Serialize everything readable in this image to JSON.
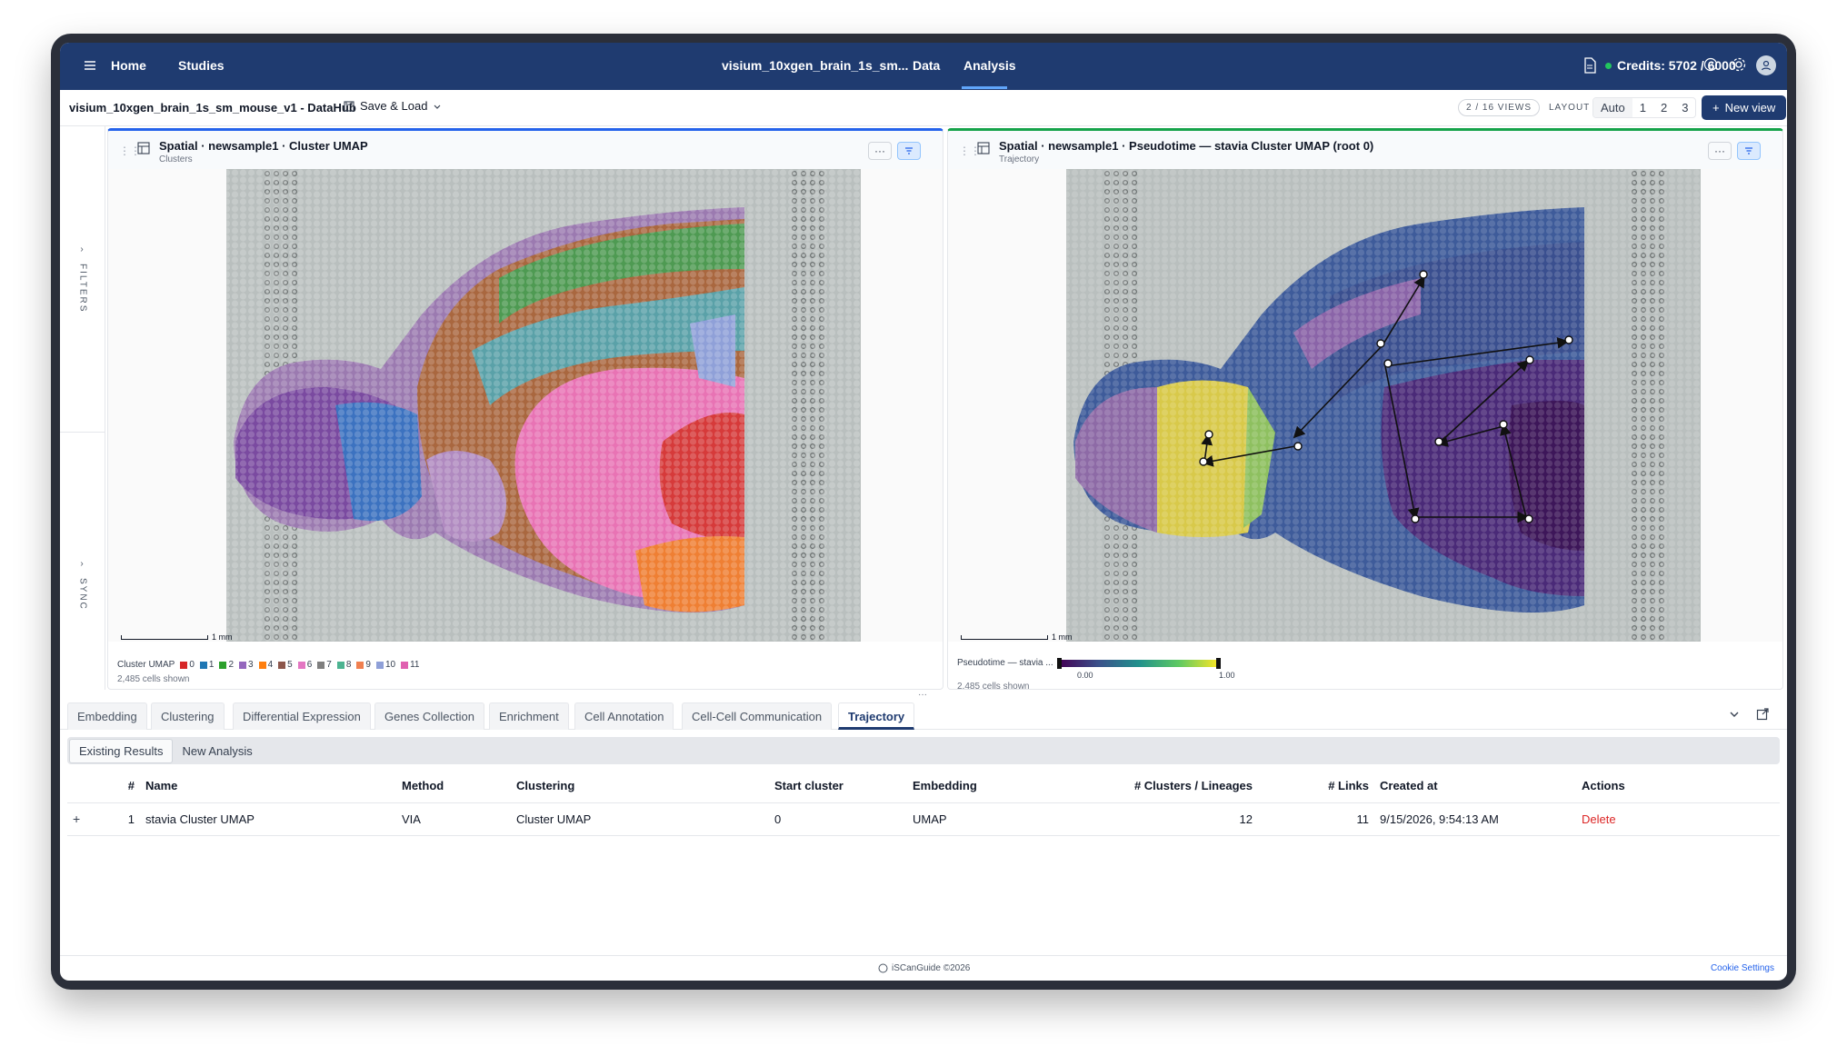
{
  "nav": {
    "home": "Home",
    "studies": "Studies",
    "study": "visium_10xgen_brain_1s_sm...",
    "data": "Data",
    "analysis": "Analysis",
    "credits": "Credits: 5702 / 6000"
  },
  "toolbar": {
    "study_title": "visium_10xgen_brain_1s_sm_mouse_v1 - DataHub",
    "save_load": "Save & Load",
    "views_badge": "2 / 16 VIEWS",
    "layout_label": "LAYOUT",
    "layout_options": [
      "Auto",
      "1",
      "2",
      "3"
    ],
    "new_view": "New view"
  },
  "siderail": {
    "filters": "FILTERS",
    "sync": "SYNC"
  },
  "panels": {
    "left": {
      "title": "Spatial · newsample1 · Cluster UMAP",
      "subtitle": "Clusters",
      "scale": "1 mm",
      "legend_title": "Cluster UMAP",
      "legend": [
        {
          "label": "0",
          "color": "#d62728"
        },
        {
          "label": "1",
          "color": "#1f77b4"
        },
        {
          "label": "2",
          "color": "#2ca02c"
        },
        {
          "label": "3",
          "color": "#9467bd"
        },
        {
          "label": "4",
          "color": "#ff7f0e"
        },
        {
          "label": "5",
          "color": "#8c564b"
        },
        {
          "label": "6",
          "color": "#e377c2"
        },
        {
          "label": "7",
          "color": "#7f7f7f"
        },
        {
          "label": "8",
          "color": "#4cb391"
        },
        {
          "label": "9",
          "color": "#f08050"
        },
        {
          "label": "10",
          "color": "#8fa0d8"
        },
        {
          "label": "11",
          "color": "#e060b0"
        }
      ],
      "cells": "2,485 cells shown"
    },
    "right": {
      "title": "Spatial · newsample1 · Pseudotime — stavia Cluster UMAP (root 0)",
      "subtitle": "Trajectory",
      "scale": "1 mm",
      "legend_title": "Pseudotime — stavia ...",
      "tick_min": "0.00",
      "tick_max": "1.00",
      "cells": "2,485 cells shown"
    }
  },
  "tabs": [
    "Embedding",
    "Clustering",
    "Differential Expression",
    "Genes Collection",
    "Enrichment",
    "Cell Annotation",
    "Cell-Cell Communication",
    "Trajectory"
  ],
  "subtabs": [
    "Existing Results",
    "New Analysis"
  ],
  "table": {
    "headers": [
      "",
      "#",
      "Name",
      "Method",
      "Clustering",
      "Start cluster",
      "Embedding",
      "# Clusters / Lineages",
      "# Links",
      "Created at",
      "Actions"
    ],
    "rows": [
      {
        "expand": "+",
        "index": "1",
        "name": "stavia Cluster UMAP",
        "method": "VIA",
        "clustering": "Cluster UMAP",
        "start": "0",
        "embedding": "UMAP",
        "clusters": "12",
        "links": "11",
        "created": "9/15/2026, 9:54:13 AM",
        "action": "Delete"
      }
    ]
  },
  "footer": {
    "copyright": "iSCanGuide ©2026",
    "cookie": "Cookie Settings"
  }
}
